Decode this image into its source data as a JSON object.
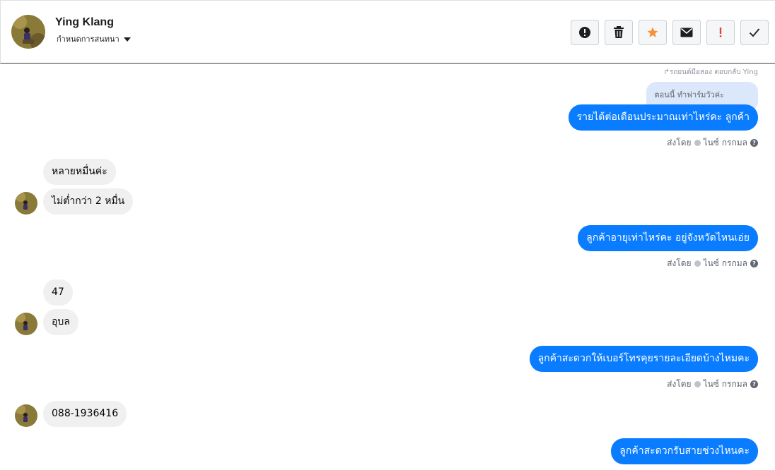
{
  "header": {
    "name": "Ying Klang",
    "assign_label": "กำหนดการสนทนา",
    "toolbar": [
      {
        "icon": "alert-circle-icon",
        "label": "spam"
      },
      {
        "icon": "trash-icon",
        "label": "delete"
      },
      {
        "icon": "star-icon",
        "label": "star"
      },
      {
        "icon": "envelope-icon",
        "label": "mark-unread"
      },
      {
        "icon": "exclamation-icon",
        "label": "follow-up"
      },
      {
        "icon": "checkmark-icon",
        "label": "done"
      }
    ]
  },
  "thread": {
    "reply_meta": "↱รถยนต์มือสอง ตอบกลับ Ying",
    "reply_quote": "ตอนนี้ ทำฟาร์มวัวค่ะ",
    "messages": [
      {
        "dir": "out",
        "text": "รายได้ต่อเดือนประมาณเท่าไหร่คะ ลูกค้า"
      },
      {
        "dir": "in",
        "text": "หลายหมื่นค่ะ"
      },
      {
        "dir": "in",
        "text": "ไม่ต่ำกว่า 2 หมื่น"
      },
      {
        "dir": "out",
        "text": "ลูกค้าอายุเท่าไหร่คะ อยู่จังหวัดไหนเอ่ย"
      },
      {
        "dir": "in",
        "text": "47"
      },
      {
        "dir": "in",
        "text": "อุบล"
      },
      {
        "dir": "out",
        "text": "ลูกค้าสะดวกให้เบอร์โทรคุยรายละเอียดบ้างไหมคะ"
      },
      {
        "dir": "in",
        "text": "088-1936416"
      },
      {
        "dir": "out",
        "text": "ลูกค้าสะดวกรับสายช่วงไหนคะ"
      }
    ],
    "sent_by_label": "ส่งโดย",
    "sent_by_name": "ไนซ์ กรกมล",
    "help_glyph": "?"
  },
  "colors": {
    "outgoing_bubble": "#0a7cff",
    "incoming_bubble": "#f0f0f0",
    "star": "#f7923b",
    "exclamation": "#e0433a"
  }
}
